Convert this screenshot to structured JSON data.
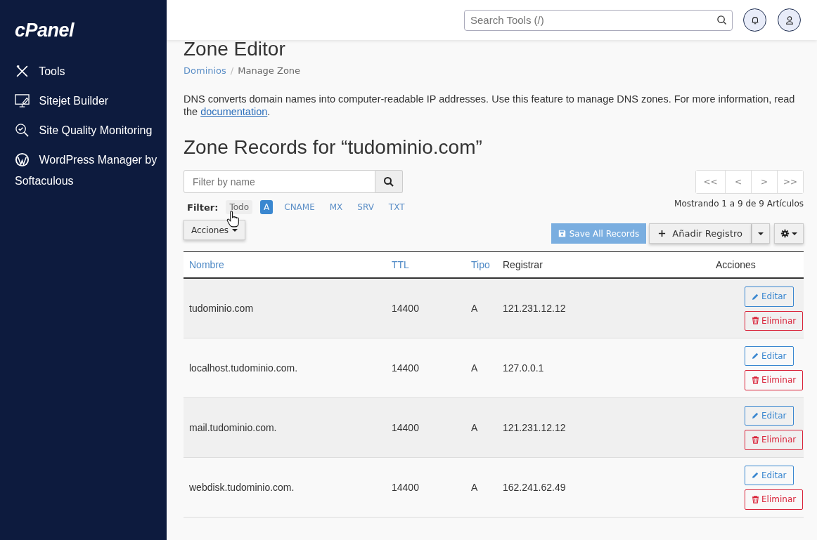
{
  "sidebar": {
    "logo": "cPanel",
    "items": [
      {
        "label": "Tools"
      },
      {
        "label": "Sitejet Builder"
      },
      {
        "label": "Site Quality Monitoring"
      },
      {
        "label": "WordPress Manager by Softaculous"
      }
    ]
  },
  "header": {
    "search": {
      "placeholder": "Search Tools (/)"
    }
  },
  "page": {
    "title": "Zone Editor",
    "breadcrumb": [
      {
        "label": "Dominios",
        "link": true
      },
      {
        "label": "Manage Zone",
        "link": false
      }
    ],
    "breadcrumb_separator": "/",
    "intro": "DNS converts domain names into computer-readable IP addresses. Use this feature to manage DNS zones. For more information, read the ",
    "intro_link": "documentation",
    "intro_end": ".",
    "records_title": "Zone Records for “tudominio.com”",
    "filter_field": {
      "placeholder": "Filter by name"
    },
    "filter_label": "Filter:",
    "filters": [
      {
        "label": "Todo",
        "selected": false
      },
      {
        "label": "A",
        "selected": true
      },
      {
        "label": "CNAME",
        "selected": false
      },
      {
        "label": "MX",
        "selected": false
      },
      {
        "label": "SRV",
        "selected": false
      },
      {
        "label": "TXT",
        "selected": false
      }
    ],
    "pager": [
      "<<",
      "<",
      ">",
      ">>"
    ],
    "pager_info": "Mostrando 1 a 9 de 9 Artículos",
    "actions_button": "Acciones",
    "save_button": "Save All Records",
    "add_button": "Añadir Registro",
    "table": {
      "columns": [
        {
          "label": "Nombre",
          "sortable": true
        },
        {
          "label": "TTL",
          "sortable": true
        },
        {
          "label": "Tipo",
          "sortable": true
        },
        {
          "label": "Registrar",
          "sortable": false
        },
        {
          "label": "Acciones",
          "sortable": false
        }
      ],
      "rows": [
        {
          "name": "tudominio.com",
          "ttl": "14400",
          "type": "A",
          "record": "121.231.12.12",
          "edit": "Editar",
          "delete": "Eliminar"
        },
        {
          "name": "localhost.tudominio.com.",
          "ttl": "14400",
          "type": "A",
          "record": "127.0.0.1",
          "edit": "Editar",
          "delete": "Eliminar"
        },
        {
          "name": "mail.tudominio.com.",
          "ttl": "14400",
          "type": "A",
          "record": "121.231.12.12",
          "edit": "Editar",
          "delete": "Eliminar"
        },
        {
          "name": "webdisk.tudominio.com.",
          "ttl": "14400",
          "type": "A",
          "record": "162.241.62.49",
          "edit": "Editar",
          "delete": "Eliminar"
        }
      ]
    }
  }
}
